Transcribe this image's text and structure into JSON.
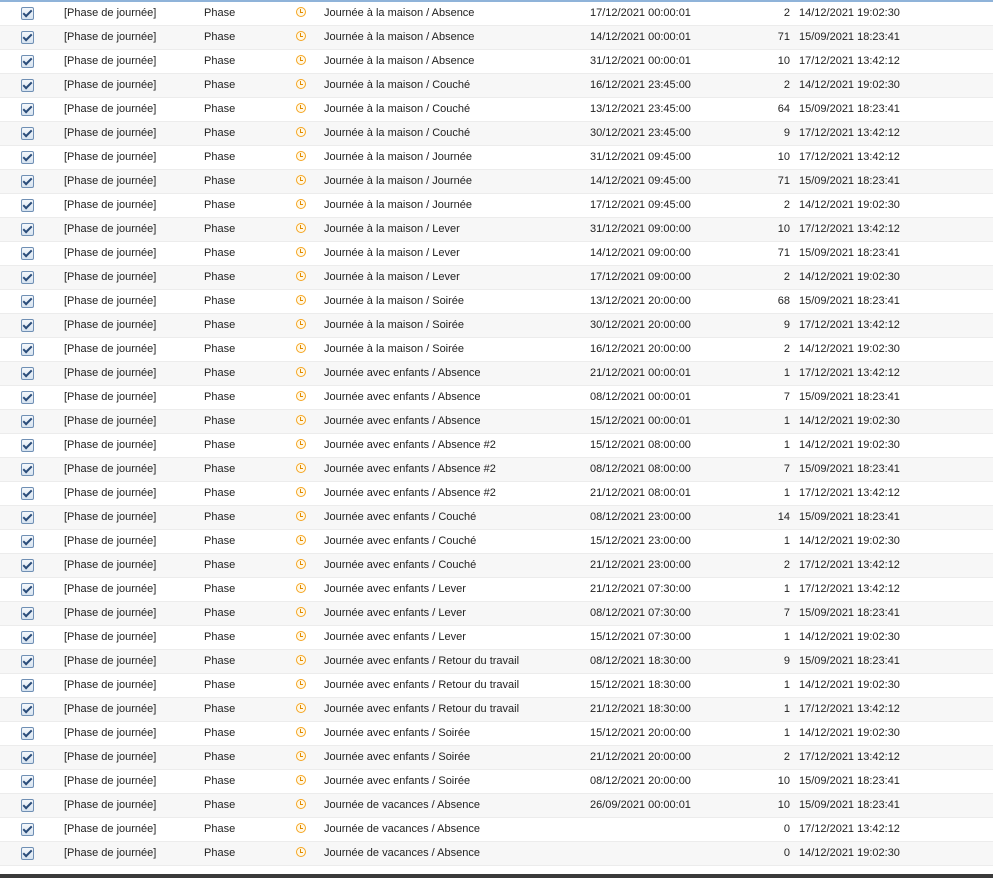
{
  "rows": [
    {
      "type": "[Phase de journée]",
      "kind": "Phase",
      "name": "Journée à la maison / Absence",
      "next": "17/12/2021 00:00:01",
      "count": "2",
      "date": "14/12/2021 19:02:30"
    },
    {
      "type": "[Phase de journée]",
      "kind": "Phase",
      "name": "Journée à la maison / Absence",
      "next": "14/12/2021 00:00:01",
      "count": "71",
      "date": "15/09/2021 18:23:41"
    },
    {
      "type": "[Phase de journée]",
      "kind": "Phase",
      "name": "Journée à la maison / Absence",
      "next": "31/12/2021 00:00:01",
      "count": "10",
      "date": "17/12/2021 13:42:12"
    },
    {
      "type": "[Phase de journée]",
      "kind": "Phase",
      "name": "Journée à la maison / Couché",
      "next": "16/12/2021 23:45:00",
      "count": "2",
      "date": "14/12/2021 19:02:30"
    },
    {
      "type": "[Phase de journée]",
      "kind": "Phase",
      "name": "Journée à la maison / Couché",
      "next": "13/12/2021 23:45:00",
      "count": "64",
      "date": "15/09/2021 18:23:41"
    },
    {
      "type": "[Phase de journée]",
      "kind": "Phase",
      "name": "Journée à la maison / Couché",
      "next": "30/12/2021 23:45:00",
      "count": "9",
      "date": "17/12/2021 13:42:12"
    },
    {
      "type": "[Phase de journée]",
      "kind": "Phase",
      "name": "Journée à la maison / Journée",
      "next": "31/12/2021 09:45:00",
      "count": "10",
      "date": "17/12/2021 13:42:12"
    },
    {
      "type": "[Phase de journée]",
      "kind": "Phase",
      "name": "Journée à la maison / Journée",
      "next": "14/12/2021 09:45:00",
      "count": "71",
      "date": "15/09/2021 18:23:41"
    },
    {
      "type": "[Phase de journée]",
      "kind": "Phase",
      "name": "Journée à la maison / Journée",
      "next": "17/12/2021 09:45:00",
      "count": "2",
      "date": "14/12/2021 19:02:30"
    },
    {
      "type": "[Phase de journée]",
      "kind": "Phase",
      "name": "Journée à la maison / Lever",
      "next": "31/12/2021 09:00:00",
      "count": "10",
      "date": "17/12/2021 13:42:12"
    },
    {
      "type": "[Phase de journée]",
      "kind": "Phase",
      "name": "Journée à la maison / Lever",
      "next": "14/12/2021 09:00:00",
      "count": "71",
      "date": "15/09/2021 18:23:41"
    },
    {
      "type": "[Phase de journée]",
      "kind": "Phase",
      "name": "Journée à la maison / Lever",
      "next": "17/12/2021 09:00:00",
      "count": "2",
      "date": "14/12/2021 19:02:30"
    },
    {
      "type": "[Phase de journée]",
      "kind": "Phase",
      "name": "Journée à la maison / Soirée",
      "next": "13/12/2021 20:00:00",
      "count": "68",
      "date": "15/09/2021 18:23:41"
    },
    {
      "type": "[Phase de journée]",
      "kind": "Phase",
      "name": "Journée à la maison / Soirée",
      "next": "30/12/2021 20:00:00",
      "count": "9",
      "date": "17/12/2021 13:42:12"
    },
    {
      "type": "[Phase de journée]",
      "kind": "Phase",
      "name": "Journée à la maison / Soirée",
      "next": "16/12/2021 20:00:00",
      "count": "2",
      "date": "14/12/2021 19:02:30"
    },
    {
      "type": "[Phase de journée]",
      "kind": "Phase",
      "name": "Journée avec enfants / Absence",
      "next": "21/12/2021 00:00:01",
      "count": "1",
      "date": "17/12/2021 13:42:12"
    },
    {
      "type": "[Phase de journée]",
      "kind": "Phase",
      "name": "Journée avec enfants / Absence",
      "next": "08/12/2021 00:00:01",
      "count": "7",
      "date": "15/09/2021 18:23:41"
    },
    {
      "type": "[Phase de journée]",
      "kind": "Phase",
      "name": "Journée avec enfants / Absence",
      "next": "15/12/2021 00:00:01",
      "count": "1",
      "date": "14/12/2021 19:02:30"
    },
    {
      "type": "[Phase de journée]",
      "kind": "Phase",
      "name": "Journée avec enfants / Absence #2",
      "next": "15/12/2021 08:00:00",
      "count": "1",
      "date": "14/12/2021 19:02:30"
    },
    {
      "type": "[Phase de journée]",
      "kind": "Phase",
      "name": "Journée avec enfants / Absence #2",
      "next": "08/12/2021 08:00:00",
      "count": "7",
      "date": "15/09/2021 18:23:41"
    },
    {
      "type": "[Phase de journée]",
      "kind": "Phase",
      "name": "Journée avec enfants / Absence #2",
      "next": "21/12/2021 08:00:01",
      "count": "1",
      "date": "17/12/2021 13:42:12"
    },
    {
      "type": "[Phase de journée]",
      "kind": "Phase",
      "name": "Journée avec enfants / Couché",
      "next": "08/12/2021 23:00:00",
      "count": "14",
      "date": "15/09/2021 18:23:41"
    },
    {
      "type": "[Phase de journée]",
      "kind": "Phase",
      "name": "Journée avec enfants / Couché",
      "next": "15/12/2021 23:00:00",
      "count": "1",
      "date": "14/12/2021 19:02:30"
    },
    {
      "type": "[Phase de journée]",
      "kind": "Phase",
      "name": "Journée avec enfants / Couché",
      "next": "21/12/2021 23:00:00",
      "count": "2",
      "date": "17/12/2021 13:42:12"
    },
    {
      "type": "[Phase de journée]",
      "kind": "Phase",
      "name": "Journée avec enfants / Lever",
      "next": "21/12/2021 07:30:00",
      "count": "1",
      "date": "17/12/2021 13:42:12"
    },
    {
      "type": "[Phase de journée]",
      "kind": "Phase",
      "name": "Journée avec enfants / Lever",
      "next": "08/12/2021 07:30:00",
      "count": "7",
      "date": "15/09/2021 18:23:41"
    },
    {
      "type": "[Phase de journée]",
      "kind": "Phase",
      "name": "Journée avec enfants / Lever",
      "next": "15/12/2021 07:30:00",
      "count": "1",
      "date": "14/12/2021 19:02:30"
    },
    {
      "type": "[Phase de journée]",
      "kind": "Phase",
      "name": "Journée avec enfants / Retour du travail",
      "next": "08/12/2021 18:30:00",
      "count": "9",
      "date": "15/09/2021 18:23:41"
    },
    {
      "type": "[Phase de journée]",
      "kind": "Phase",
      "name": "Journée avec enfants / Retour du travail",
      "next": "15/12/2021 18:30:00",
      "count": "1",
      "date": "14/12/2021 19:02:30"
    },
    {
      "type": "[Phase de journée]",
      "kind": "Phase",
      "name": "Journée avec enfants / Retour du travail",
      "next": "21/12/2021 18:30:00",
      "count": "1",
      "date": "17/12/2021 13:42:12"
    },
    {
      "type": "[Phase de journée]",
      "kind": "Phase",
      "name": "Journée avec enfants / Soirée",
      "next": "15/12/2021 20:00:00",
      "count": "1",
      "date": "14/12/2021 19:02:30"
    },
    {
      "type": "[Phase de journée]",
      "kind": "Phase",
      "name": "Journée avec enfants / Soirée",
      "next": "21/12/2021 20:00:00",
      "count": "2",
      "date": "17/12/2021 13:42:12"
    },
    {
      "type": "[Phase de journée]",
      "kind": "Phase",
      "name": "Journée avec enfants / Soirée",
      "next": "08/12/2021 20:00:00",
      "count": "10",
      "date": "15/09/2021 18:23:41"
    },
    {
      "type": "[Phase de journée]",
      "kind": "Phase",
      "name": "Journée de vacances / Absence",
      "next": "26/09/2021 00:00:01",
      "count": "10",
      "date": "15/09/2021 18:23:41"
    },
    {
      "type": "[Phase de journée]",
      "kind": "Phase",
      "name": "Journée de vacances / Absence",
      "next": "",
      "count": "0",
      "date": "17/12/2021 13:42:12"
    },
    {
      "type": "[Phase de journée]",
      "kind": "Phase",
      "name": "Journée de vacances / Absence",
      "next": "",
      "count": "0",
      "date": "14/12/2021 19:02:30"
    }
  ],
  "icons": {
    "row_icon": "alarm-clock-icon",
    "checkbox": "checkbox-checked-icon"
  },
  "colors": {
    "icon_accent": "#f5a623",
    "row_alt": "#f7f7f7",
    "border": "#ececec"
  }
}
